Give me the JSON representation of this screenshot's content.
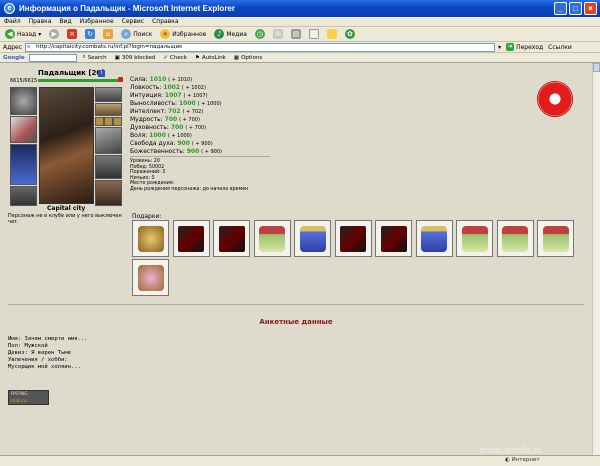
{
  "window": {
    "title": "Информация о Падальщик - Microsoft Internet Explorer"
  },
  "menu": [
    "Файл",
    "Правка",
    "Вид",
    "Избранное",
    "Сервис",
    "Справка"
  ],
  "toolbar": {
    "back": "Назад",
    "search": "Поиск",
    "favorites": "Избранное",
    "media": "Медиа"
  },
  "address": {
    "label": "Адрес",
    "url": "http://capitalcity.combats.ru/inf.pl?login=падальщик",
    "go": "Переход",
    "links": "Ссылки"
  },
  "googlebar": {
    "brand": "Google",
    "search": "Search",
    "blocked": "309 blocked",
    "check": "Check",
    "autolink": "AutoLink",
    "options": "Options"
  },
  "character": {
    "name": "Падальщик [20]",
    "hp": "6615/6615",
    "city": "Capital city",
    "offline_note": "Персонаж не в клубе или у него выключен чат."
  },
  "stats": [
    {
      "label": "Сила:",
      "value": "1010",
      "bonus": "( + 1010)"
    },
    {
      "label": "Ловкость:",
      "value": "1002",
      "bonus": "( + 1002)"
    },
    {
      "label": "Интуиция:",
      "value": "1007",
      "bonus": "( + 1007)"
    },
    {
      "label": "Выносливость:",
      "value": "1000",
      "bonus": "( + 1000)"
    },
    {
      "label": "Интеллект:",
      "value": "702",
      "bonus": "( + 702)"
    },
    {
      "label": "Мудрость:",
      "value": "700",
      "bonus": "( + 700)"
    },
    {
      "label": "Духовность:",
      "value": "700",
      "bonus": "( + 700)"
    },
    {
      "label": "Воля:",
      "value": "1000",
      "bonus": "( + 1000)"
    },
    {
      "label": "Свобода духа:",
      "value": "900",
      "bonus": "( + 900)"
    },
    {
      "label": "Божественность:",
      "value": "900",
      "bonus": "( + 900)"
    }
  ],
  "info": [
    "Уровень: 20",
    "Побед: 50002",
    "Поражений: 3",
    "Ничьих: 0",
    "Место рождения:",
    "День рождения персонажа: до начала времен"
  ],
  "gifts": {
    "label": "Подарки:",
    "items": [
      "golden-cage-icon",
      "dark-gift-bag-icon",
      "dark-gift-bag-icon",
      "gift-box-icon",
      "blue-jar-icon",
      "dark-gift-bag-icon",
      "dark-gift-bag-icon",
      "blue-jar-icon",
      "gift-box-icon",
      "gift-box-icon",
      "gift-box-icon",
      "flower-basket-icon"
    ]
  },
  "anketa": {
    "title": "Анкетные данные",
    "lines": [
      "Имя: Зачем смерти имя...",
      "Пол: Мужской",
      "Девиз: Я верен Тьме",
      "Увлечения / хобби:",
      "Мусорщик мой холяин..."
    ]
  },
  "counter": {
    "line1": "RATING",
    "line2": "mail.ru"
  },
  "status": {
    "zone": "Интернет"
  },
  "watermark": "photo.scrolls.ru"
}
